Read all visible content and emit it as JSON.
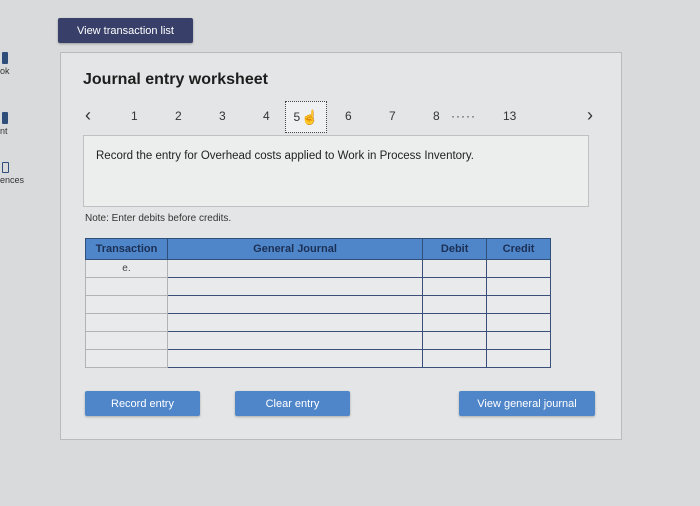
{
  "sidebar": {
    "items": [
      {
        "label": "ok",
        "icon": "bookmark-icon"
      },
      {
        "label": "nt",
        "icon": "bookmark-icon"
      },
      {
        "label": "ences",
        "icon": "reference-icon"
      }
    ]
  },
  "top_button": {
    "label": "View transaction list"
  },
  "worksheet": {
    "title": "Journal entry worksheet",
    "pager": {
      "prev": "‹",
      "next": "›",
      "pages": [
        "1",
        "2",
        "3",
        "4",
        "5",
        "6",
        "7",
        "8"
      ],
      "current": "5",
      "ellipsis": "·····",
      "last": "13"
    },
    "instruction": "Record the entry for Overhead costs applied to Work in Process Inventory.",
    "note": "Note: Enter debits before credits."
  },
  "table": {
    "headers": [
      "Transaction",
      "General Journal",
      "Debit",
      "Credit"
    ],
    "rows": [
      [
        "e.",
        "",
        "",
        ""
      ],
      [
        "",
        "",
        "",
        ""
      ],
      [
        "",
        "",
        "",
        ""
      ],
      [
        "",
        "",
        "",
        ""
      ],
      [
        "",
        "",
        "",
        ""
      ],
      [
        "",
        "",
        "",
        ""
      ]
    ]
  },
  "buttons": {
    "record": "Record entry",
    "clear": "Clear entry",
    "view_journal": "View general journal"
  },
  "colors": {
    "primary": "#4f86c9",
    "dark_button": "#38406a",
    "background": "#d9dadb"
  }
}
